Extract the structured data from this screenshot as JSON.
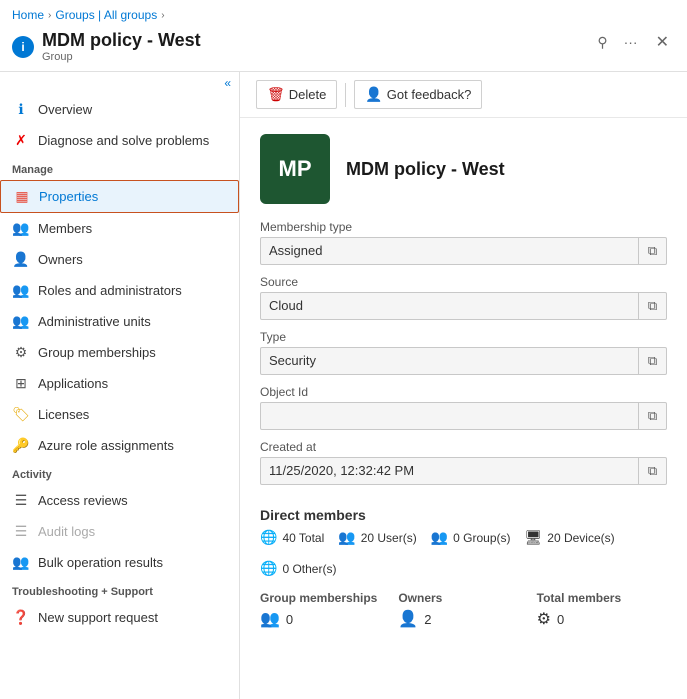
{
  "breadcrumb": {
    "items": [
      "Home",
      "Groups | All groups"
    ],
    "separators": [
      ">",
      ">"
    ]
  },
  "header": {
    "icon_label": "i",
    "title": "MDM policy - West",
    "subtitle": "Group",
    "pin_icon": "📌",
    "more_icon": "···",
    "close_icon": "✕"
  },
  "toolbar": {
    "delete_label": "Delete",
    "feedback_label": "Got feedback?"
  },
  "sidebar": {
    "collapse_icon": "«",
    "items": [
      {
        "id": "overview",
        "label": "Overview",
        "icon": "ℹ",
        "active": false
      },
      {
        "id": "diagnose",
        "label": "Diagnose and solve problems",
        "icon": "✘",
        "active": false
      }
    ],
    "sections": [
      {
        "title": "Manage",
        "items": [
          {
            "id": "properties",
            "label": "Properties",
            "icon": "▦",
            "active": true
          },
          {
            "id": "members",
            "label": "Members",
            "icon": "👥",
            "active": false
          },
          {
            "id": "owners",
            "label": "Owners",
            "icon": "👤",
            "active": false
          },
          {
            "id": "roles",
            "label": "Roles and administrators",
            "icon": "👥",
            "active": false
          },
          {
            "id": "admin-units",
            "label": "Administrative units",
            "icon": "👥",
            "active": false
          },
          {
            "id": "group-memberships",
            "label": "Group memberships",
            "icon": "⚙",
            "active": false
          },
          {
            "id": "applications",
            "label": "Applications",
            "icon": "⊞",
            "active": false
          },
          {
            "id": "licenses",
            "label": "Licenses",
            "icon": "🏷",
            "active": false
          },
          {
            "id": "azure-roles",
            "label": "Azure role assignments",
            "icon": "🔑",
            "active": false
          }
        ]
      },
      {
        "title": "Activity",
        "items": [
          {
            "id": "access-reviews",
            "label": "Access reviews",
            "icon": "☰",
            "active": false
          },
          {
            "id": "audit-logs",
            "label": "Audit logs",
            "icon": "☰",
            "active": false
          },
          {
            "id": "bulk-results",
            "label": "Bulk operation results",
            "icon": "👥",
            "active": false
          }
        ]
      },
      {
        "title": "Troubleshooting + Support",
        "items": [
          {
            "id": "new-support",
            "label": "New support request",
            "icon": "❓",
            "active": false
          }
        ]
      }
    ]
  },
  "profile": {
    "avatar_text": "MP",
    "name": "MDM policy - West"
  },
  "fields": [
    {
      "id": "membership-type",
      "label": "Membership type",
      "value": "Assigned"
    },
    {
      "id": "source",
      "label": "Source",
      "value": "Cloud"
    },
    {
      "id": "type",
      "label": "Type",
      "value": "Security"
    },
    {
      "id": "object-id",
      "label": "Object Id",
      "value": ""
    },
    {
      "id": "created-at",
      "label": "Created at",
      "value": "11/25/2020, 12:32:42 PM"
    }
  ],
  "direct_members": {
    "title": "Direct members",
    "stats": [
      {
        "id": "total",
        "icon": "🌐",
        "label": "40 Total"
      },
      {
        "id": "users",
        "icon": "👥",
        "label": "20 User(s)"
      },
      {
        "id": "groups",
        "icon": "👥",
        "label": "0 Group(s)"
      },
      {
        "id": "devices",
        "icon": "🖥",
        "label": "20 Device(s)"
      },
      {
        "id": "others",
        "icon": "🌐",
        "label": "0 Other(s)"
      }
    ]
  },
  "bottom_grid": [
    {
      "id": "group-memberships",
      "title": "Group memberships",
      "icon": "👥",
      "value": "0"
    },
    {
      "id": "owners",
      "title": "Owners",
      "icon": "👤",
      "value": "2"
    },
    {
      "id": "total-members",
      "title": "Total members",
      "icon": "⚙",
      "value": "0"
    }
  ]
}
